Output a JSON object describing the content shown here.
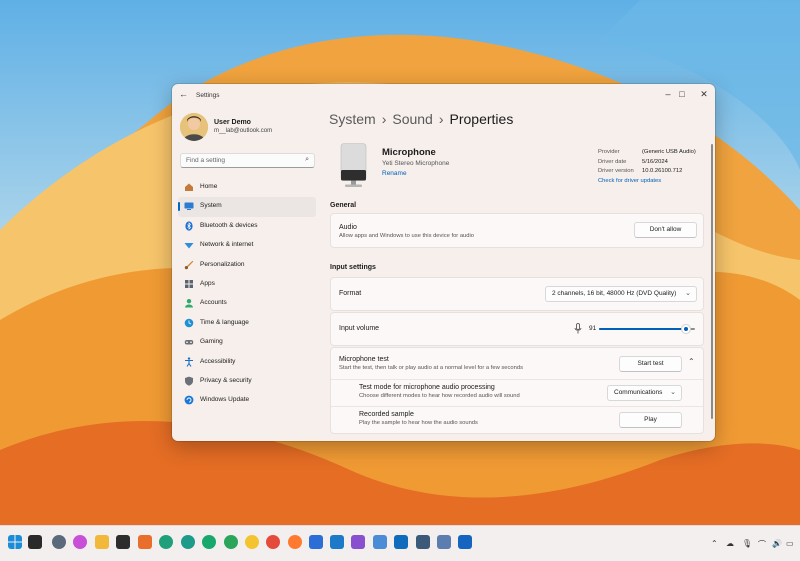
{
  "window": {
    "app_title": "Settings"
  },
  "user": {
    "name": "User Demo",
    "email": "m__lab@outlook.com"
  },
  "search": {
    "placeholder": "Find a setting"
  },
  "sidebar": {
    "items": [
      {
        "label": "Home",
        "icon": "home-icon",
        "color": "#c47a3a"
      },
      {
        "label": "System",
        "icon": "system-icon",
        "color": "#2b7bd1",
        "active": true
      },
      {
        "label": "Bluetooth & devices",
        "icon": "bluetooth-icon",
        "color": "#1e6fd4"
      },
      {
        "label": "Network & internet",
        "icon": "network-icon",
        "color": "#2a8fe0"
      },
      {
        "label": "Personalization",
        "icon": "brush-icon",
        "color": "#d9852f"
      },
      {
        "label": "Apps",
        "icon": "apps-icon",
        "color": "#5b6470"
      },
      {
        "label": "Accounts",
        "icon": "accounts-icon",
        "color": "#2eaa6a"
      },
      {
        "label": "Time & language",
        "icon": "globe-clock-icon",
        "color": "#1f8fd6"
      },
      {
        "label": "Gaming",
        "icon": "gamepad-icon",
        "color": "#6c6f74"
      },
      {
        "label": "Accessibility",
        "icon": "accessibility-icon",
        "color": "#1d6fc6"
      },
      {
        "label": "Privacy & security",
        "icon": "shield-icon",
        "color": "#6b7178"
      },
      {
        "label": "Windows Update",
        "icon": "update-icon",
        "color": "#1a78d4"
      }
    ]
  },
  "breadcrumb": {
    "part1": "System",
    "part2": "Sound",
    "current": "Properties",
    "sep": "›"
  },
  "device": {
    "name": "Microphone",
    "model": "Yeti Stereo Microphone",
    "rename": "Rename",
    "provider_label": "Provider",
    "provider": "(Generic USB Audio)",
    "date_label": "Driver date",
    "date": "5/16/2024",
    "version_label": "Driver version",
    "version": "10.0.26100.712",
    "update_link": "Check for driver updates"
  },
  "general": {
    "heading": "General",
    "audio_title": "Audio",
    "audio_desc": "Allow apps and Windows to use this device for audio",
    "audio_button": "Don't allow"
  },
  "input_settings": {
    "heading": "Input settings",
    "format_label": "Format",
    "format_value": "2 channels, 16 bit, 48000 Hz (DVD Quality)",
    "volume_label": "Input volume",
    "volume_value": "91",
    "volume_level": 91,
    "mic_test_title": "Microphone test",
    "mic_test_desc": "Start the test, then talk or play audio at a normal level for a few seconds",
    "start_test_button": "Start test",
    "test_mode_title": "Test mode for microphone audio processing",
    "test_mode_desc": "Choose different modes to hear how recorded audio will sound",
    "test_mode_value": "Communications",
    "recorded_title": "Recorded sample",
    "recorded_desc": "Play the sample to hear how the audio sounds",
    "play_button": "Play"
  },
  "colors": {
    "accent": "#005fb8",
    "window_bg": "#f6efec"
  }
}
